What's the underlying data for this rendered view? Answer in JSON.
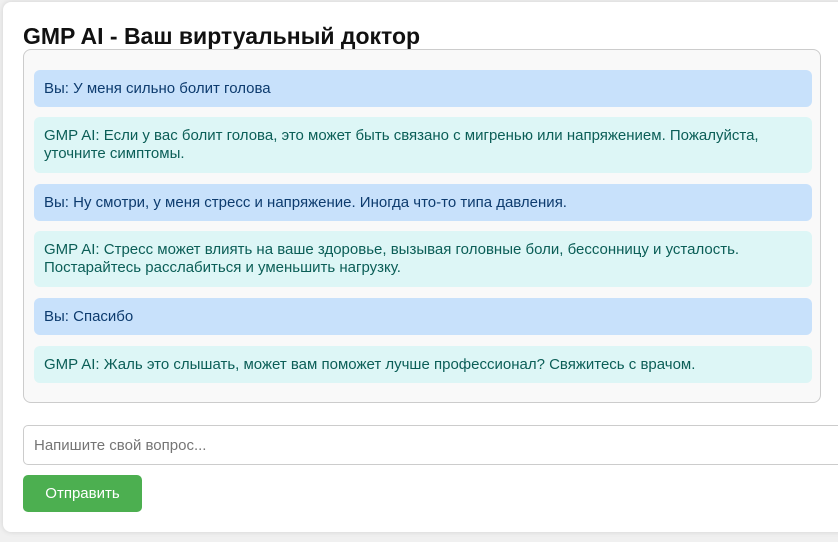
{
  "app": {
    "title": "GMP AI - Ваш виртуальный доктор"
  },
  "chat": {
    "messages": [
      {
        "role": "user",
        "text": "Вы: У меня сильно болит голова"
      },
      {
        "role": "bot",
        "text": "GMP AI: Если у вас болит голова, это может быть связано с мигренью или напряжением. Пожалуйста, уточните симптомы."
      },
      {
        "role": "user",
        "text": "Вы: Ну смотри, у меня стресс и напряжение. Иногда что-то типа давления."
      },
      {
        "role": "bot",
        "text": "GMP AI: Стресс может влиять на ваше здоровье, вызывая головные боли, бессонницу и усталость. Постарайтесь расслабиться и уменьшить нагрузку."
      },
      {
        "role": "user",
        "text": "Вы: Спасибо"
      },
      {
        "role": "bot",
        "text": "GMP AI: Жаль это слышать, может вам поможет лучше профессионал? Свяжитесь с врачом."
      }
    ]
  },
  "input": {
    "placeholder": "Напишите свой вопрос...",
    "value": ""
  },
  "send_button": {
    "label": "Отправить"
  },
  "colors": {
    "user_bubble": "#c8e1fb",
    "bot_bubble": "#ddf6f6",
    "send_button": "#4caf50"
  }
}
